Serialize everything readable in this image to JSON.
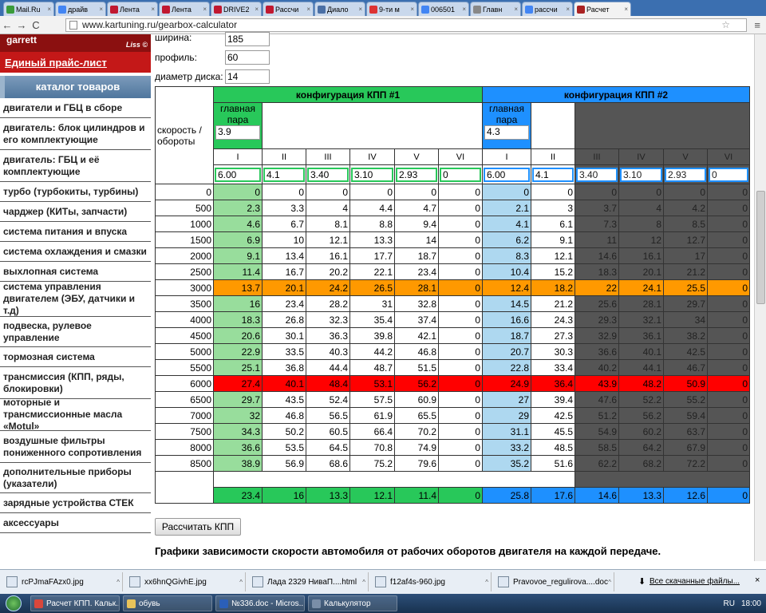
{
  "browser": {
    "tabs": [
      {
        "title": "Mail.Ru",
        "icon_color": "#3a9b3a",
        "icon": "mail-icon"
      },
      {
        "title": "драйв",
        "icon_color": "#4285f4",
        "icon": "google-icon"
      },
      {
        "title": "Лента",
        "icon_color": "#c01830",
        "icon": "drive2-icon"
      },
      {
        "title": "Лента",
        "icon_color": "#c01830",
        "icon": "drive2-icon"
      },
      {
        "title": "DRIVE2",
        "icon_color": "#c01830",
        "icon": "drive2-icon"
      },
      {
        "title": "Рассчи",
        "icon_color": "#c01830",
        "icon": "drive2-icon"
      },
      {
        "title": "Диало",
        "icon_color": "#4a6fa5",
        "icon": "doc-icon"
      },
      {
        "title": "9-ти м",
        "icon_color": "#d33",
        "icon": "opera-icon"
      },
      {
        "title": "006501",
        "icon_color": "#4285f4",
        "icon": "google-icon"
      },
      {
        "title": "Главн",
        "icon_color": "#888",
        "icon": "page-icon"
      },
      {
        "title": "рассчи",
        "icon_color": "#4285f4",
        "icon": "google-icon"
      },
      {
        "title": "Расчет",
        "icon_color": "#aa2222",
        "icon": "kartuning-icon",
        "active": true
      }
    ],
    "tab_close": "×",
    "url": "www.kartuning.ru/gearbox-calculator",
    "back": "←",
    "forward": "→",
    "reload": "C",
    "star": "☆",
    "menu": "≡"
  },
  "sidebar": {
    "logo_text": "garrett",
    "logo_sub": "Liss ©",
    "price_list": "Единый прайс-лист",
    "catalog_title": "каталог товаров",
    "items": [
      "двигатели и ГБЦ в сборе",
      "двигатель: блок цилиндров и его комплектующие",
      "двигатель: ГБЦ и её комплектующие",
      "турбо (турбокиты, турбины)",
      "чарджер (КИТы, запчасти)",
      "система питания и впуска",
      "система охлаждения и смазки",
      "выхлопная система",
      "система управления двигателем (ЭБУ, датчики и т.д)",
      "подвеска, рулевое управление",
      "тормозная система",
      "трансмиссия (КПП, ряды, блокировки)",
      "моторные и трансмиссионные масла «Motul»",
      "воздушные фильтры пониженного сопротивления",
      "дополнительные приборы (указатели)",
      "зарядные устройства СТЕК",
      "аксессуары"
    ]
  },
  "fields": {
    "width_label": "ширина:",
    "width_value": "185",
    "profile_label": "профиль:",
    "profile_value": "60",
    "disk_label": "диаметр диска:",
    "disk_value": "14"
  },
  "table": {
    "config1_title": "конфигурация КПП #1",
    "config2_title": "конфигурация КПП #2",
    "speed_rpm_label": "скорость / обороты",
    "main_pair_label": "главная пара",
    "main_pair_1": "3.9",
    "main_pair_2": "4.3",
    "gear_labels": [
      "I",
      "II",
      "III",
      "IV",
      "V",
      "VI",
      "I",
      "II",
      "III",
      "IV",
      "V",
      "VI"
    ],
    "ratios": [
      "6.00",
      "4.1",
      "3.40",
      "3.10",
      "2.93",
      "0",
      "6.00",
      "4.1",
      "3.40",
      "3.10",
      "2.93",
      "0"
    ],
    "rows": [
      {
        "rpm": "0",
        "v": [
          "0",
          "0",
          "0",
          "0",
          "0",
          "0",
          "0",
          "0",
          "0",
          "0",
          "0",
          "0"
        ]
      },
      {
        "rpm": "500",
        "v": [
          "2.3",
          "3.3",
          "4",
          "4.4",
          "4.7",
          "0",
          "2.1",
          "3",
          "3.7",
          "4",
          "4.2",
          "0"
        ]
      },
      {
        "rpm": "1000",
        "v": [
          "4.6",
          "6.7",
          "8.1",
          "8.8",
          "9.4",
          "0",
          "4.1",
          "6.1",
          "7.3",
          "8",
          "8.5",
          "0"
        ]
      },
      {
        "rpm": "1500",
        "v": [
          "6.9",
          "10",
          "12.1",
          "13.3",
          "14",
          "0",
          "6.2",
          "9.1",
          "11",
          "12",
          "12.7",
          "0"
        ]
      },
      {
        "rpm": "2000",
        "v": [
          "9.1",
          "13.4",
          "16.1",
          "17.7",
          "18.7",
          "0",
          "8.3",
          "12.1",
          "14.6",
          "16.1",
          "17",
          "0"
        ]
      },
      {
        "rpm": "2500",
        "v": [
          "11.4",
          "16.7",
          "20.2",
          "22.1",
          "23.4",
          "0",
          "10.4",
          "15.2",
          "18.3",
          "20.1",
          "21.2",
          "0"
        ]
      },
      {
        "rpm": "3000",
        "v": [
          "13.7",
          "20.1",
          "24.2",
          "26.5",
          "28.1",
          "0",
          "12.4",
          "18.2",
          "22",
          "24.1",
          "25.5",
          "0"
        ],
        "highlight": "orange"
      },
      {
        "rpm": "3500",
        "v": [
          "16",
          "23.4",
          "28.2",
          "31",
          "32.8",
          "0",
          "14.5",
          "21.2",
          "25.6",
          "28.1",
          "29.7",
          "0"
        ]
      },
      {
        "rpm": "4000",
        "v": [
          "18.3",
          "26.8",
          "32.3",
          "35.4",
          "37.4",
          "0",
          "16.6",
          "24.3",
          "29.3",
          "32.1",
          "34",
          "0"
        ]
      },
      {
        "rpm": "4500",
        "v": [
          "20.6",
          "30.1",
          "36.3",
          "39.8",
          "42.1",
          "0",
          "18.7",
          "27.3",
          "32.9",
          "36.1",
          "38.2",
          "0"
        ]
      },
      {
        "rpm": "5000",
        "v": [
          "22.9",
          "33.5",
          "40.3",
          "44.2",
          "46.8",
          "0",
          "20.7",
          "30.3",
          "36.6",
          "40.1",
          "42.5",
          "0"
        ]
      },
      {
        "rpm": "5500",
        "v": [
          "25.1",
          "36.8",
          "44.4",
          "48.7",
          "51.5",
          "0",
          "22.8",
          "33.4",
          "40.2",
          "44.1",
          "46.7",
          "0"
        ]
      },
      {
        "rpm": "6000",
        "v": [
          "27.4",
          "40.1",
          "48.4",
          "53.1",
          "56.2",
          "0",
          "24.9",
          "36.4",
          "43.9",
          "48.2",
          "50.9",
          "0"
        ],
        "highlight": "red"
      },
      {
        "rpm": "6500",
        "v": [
          "29.7",
          "43.5",
          "52.4",
          "57.5",
          "60.9",
          "0",
          "27",
          "39.4",
          "47.6",
          "52.2",
          "55.2",
          "0"
        ]
      },
      {
        "rpm": "7000",
        "v": [
          "32",
          "46.8",
          "56.5",
          "61.9",
          "65.5",
          "0",
          "29",
          "42.5",
          "51.2",
          "56.2",
          "59.4",
          "0"
        ]
      },
      {
        "rpm": "7500",
        "v": [
          "34.3",
          "50.2",
          "60.5",
          "66.4",
          "70.2",
          "0",
          "31.1",
          "45.5",
          "54.9",
          "60.2",
          "63.7",
          "0"
        ]
      },
      {
        "rpm": "8000",
        "v": [
          "36.6",
          "53.5",
          "64.5",
          "70.8",
          "74.9",
          "0",
          "33.2",
          "48.5",
          "58.5",
          "64.2",
          "67.9",
          "0"
        ]
      },
      {
        "rpm": "8500",
        "v": [
          "38.9",
          "56.9",
          "68.6",
          "75.2",
          "79.6",
          "0",
          "35.2",
          "51.6",
          "62.2",
          "68.2",
          "72.2",
          "0"
        ]
      }
    ],
    "diffs": [
      "23.4",
      "16",
      "13.3",
      "12.1",
      "11.4",
      "0",
      "25.8",
      "17.6",
      "14.6",
      "13.3",
      "12.6",
      "0"
    ]
  },
  "calc_button": "Рассчитать КПП",
  "graph_title": "Графики зависимости скорости автомобиля от рабочих оборотов двигателя на каждой передаче.",
  "downloads": {
    "items": [
      "rcPJmaFAzx0.jpg",
      "xx6hnQGivhE.jpg",
      "Лада 2329 НиваП....html",
      "f12af4s-960.jpg",
      "Pravovoe_regulirova....doc"
    ],
    "chevron": "^",
    "show_all": "Все скачанные файлы...",
    "close": "×"
  },
  "taskbar": {
    "items": [
      {
        "label": "Расчет КПП. Кальк...",
        "color": "#d9473b"
      },
      {
        "label": "обувь",
        "color": "#e8c35a"
      },
      {
        "label": "№336.doc - Micros...",
        "color": "#2b5fb8"
      },
      {
        "label": "Калькулятор",
        "color": "#7a8ea8"
      }
    ],
    "lang": "RU",
    "time": "18:00"
  },
  "colors": {
    "config1": "#28c85a",
    "config2": "#1e90ff",
    "rpm_orange": "#ff9900",
    "rpm_red": "#ff0000"
  }
}
